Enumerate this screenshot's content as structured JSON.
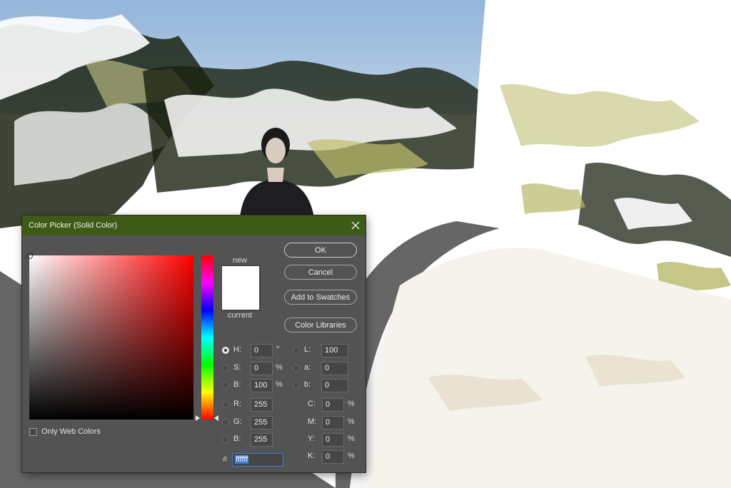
{
  "dialog": {
    "title": "Color Picker (Solid Color)",
    "buttons": {
      "ok": "OK",
      "cancel": "Cancel",
      "add_to_swatches": "Add to Swatches",
      "color_libraries": "Color Libraries"
    },
    "preview": {
      "new_label": "new",
      "current_label": "current",
      "new_color": "#ffffff",
      "current_color": "#ffffff"
    },
    "hsb": [
      {
        "label": "H:",
        "value": "0",
        "unit": "°",
        "selected": true
      },
      {
        "label": "S:",
        "value": "0",
        "unit": "%",
        "selected": false
      },
      {
        "label": "B:",
        "value": "100",
        "unit": "%",
        "selected": false
      }
    ],
    "rgb": [
      {
        "label": "R:",
        "value": "255"
      },
      {
        "label": "G:",
        "value": "255"
      },
      {
        "label": "B:",
        "value": "255"
      }
    ],
    "lab": [
      {
        "label": "L:",
        "value": "100"
      },
      {
        "label": "a:",
        "value": "0"
      },
      {
        "label": "b:",
        "value": "0"
      }
    ],
    "cmyk": [
      {
        "label": "C:",
        "value": "0",
        "unit": "%"
      },
      {
        "label": "M:",
        "value": "0",
        "unit": "%"
      },
      {
        "label": "Y:",
        "value": "0",
        "unit": "%"
      },
      {
        "label": "K:",
        "value": "0",
        "unit": "%"
      }
    ],
    "hex": {
      "hash": "#",
      "value": "ffffff"
    },
    "only_web_colors": {
      "label": "Only Web Colors",
      "checked": false
    }
  },
  "icons": {
    "close": "close-icon"
  },
  "colors": {
    "titlebar": "#3d5a17",
    "dialog_bg": "#535353",
    "hex_highlight": "#3b7dd8"
  }
}
